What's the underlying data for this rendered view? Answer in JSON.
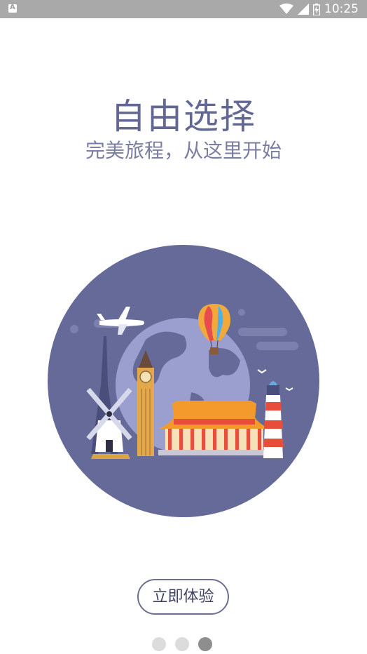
{
  "status_bar": {
    "time": "10:25",
    "notification_letter": "A"
  },
  "hero": {
    "title": "自由选择",
    "subtitle": "完美旅程，从这里开始"
  },
  "cta": {
    "label": "立即体验"
  },
  "pager": {
    "count": 3,
    "active_index": 2
  },
  "colors": {
    "circle": "#666a98",
    "title": "#626893",
    "subtitle": "#7a7ea0",
    "cta_border": "#6c6f92"
  },
  "icons": [
    "wifi-icon",
    "signal-icon",
    "battery-icon",
    "notification-icon"
  ]
}
